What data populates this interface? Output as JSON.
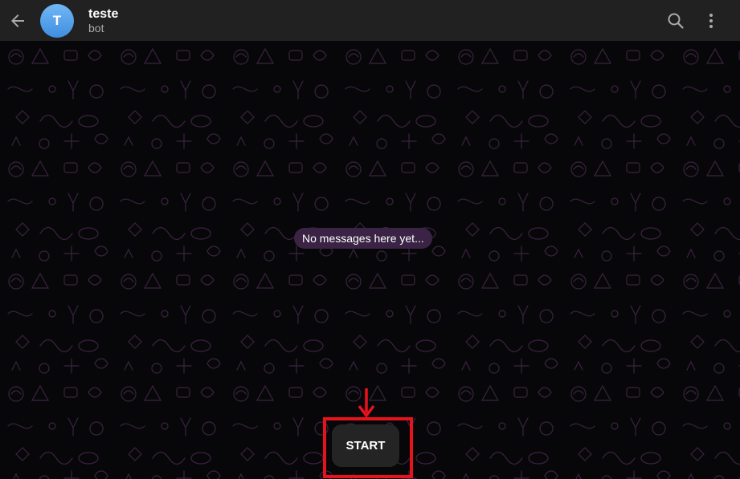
{
  "header": {
    "back_icon": "arrow-left-icon",
    "avatar_letter": "T",
    "avatar_color": "#4f9be8",
    "title": "teste",
    "subtitle": "bot",
    "search_icon": "search-icon",
    "more_icon": "more-vertical-icon"
  },
  "chat": {
    "empty_message": "No messages here yet...",
    "start_label": "START",
    "background_color": "#070709",
    "pattern_color": "#3a2240"
  },
  "annotation": {
    "highlight_color": "#e8121c"
  }
}
